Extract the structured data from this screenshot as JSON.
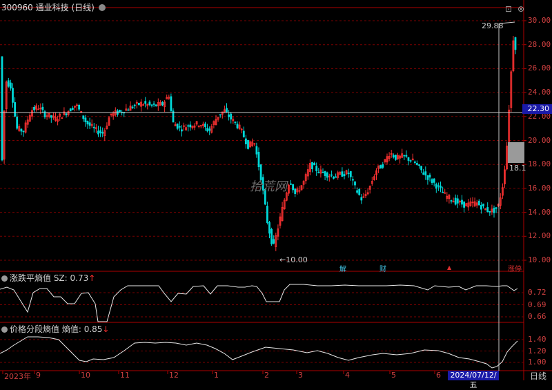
{
  "header": {
    "stock_code": "300960",
    "stock_name": "通业科技",
    "period_label": "(日线)"
  },
  "main_chart": {
    "y_ticks": [
      "30.00",
      "28.00",
      "26.00",
      "24.00",
      "22.00",
      "20.00",
      "18.00",
      "16.00",
      "14.00",
      "12.00",
      "10.00"
    ],
    "high_label": "29.88",
    "low_label": "10.00",
    "current_price": "22.30",
    "partial_label": "18.1",
    "watermark": "拾荒网",
    "event_markers": [
      {
        "text": "解",
        "color": "#40c0e0"
      },
      {
        "text": "财",
        "color": "#40c0e0"
      },
      {
        "text": "▲",
        "color": "#e03030"
      },
      {
        "text": "涨停",
        "color": "#e03030"
      }
    ]
  },
  "indicator1": {
    "title": "涨跌平熵值 SZ:",
    "value": "0.73",
    "arrow": "↑",
    "y_ticks": [
      "0.72",
      "0.69",
      "0.66"
    ]
  },
  "indicator2": {
    "title": "价格分段熵值 熵值:",
    "value": "0.85",
    "arrow": "↓",
    "y_ticks": [
      "1.40",
      "1.20",
      "1.00"
    ]
  },
  "x_axis": {
    "labels": [
      "2023年",
      "9",
      "10",
      "11",
      "12",
      "1",
      "2",
      "3",
      "4",
      "5",
      "6"
    ],
    "cursor_date": "2024/07/12/五",
    "period": "日线"
  },
  "icons": {
    "restore": "restore-icon",
    "close": "close-icon"
  },
  "colors": {
    "up": "#ff3232",
    "down": "#00d8d8",
    "grid": "#7a0000",
    "axis": "#b00000",
    "line": "#e8e8e8"
  }
}
